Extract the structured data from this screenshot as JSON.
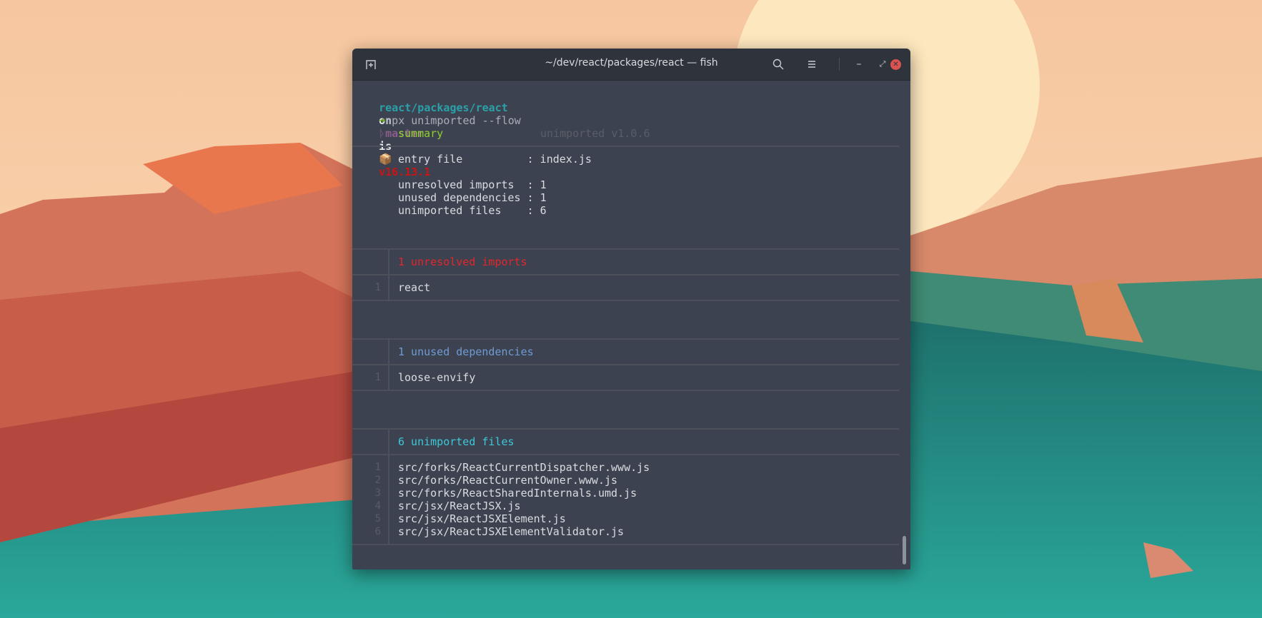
{
  "window": {
    "title": "~/dev/react/packages/react — fish",
    "new_tab_icon": "new-tab-icon",
    "search_icon": "search-icon",
    "menu_icon": "hamburger-menu-icon",
    "minimize_icon": "–",
    "maximize_icon": "⤢",
    "close_icon": "✕"
  },
  "prompt": {
    "path": "react/packages/react",
    "on": "on",
    "branch_icon": "",
    "branch": "master",
    "is": "is",
    "package_icon": "📦",
    "version": "v16.13.1",
    "arrow": "➜",
    "command": "npx unimported --flow"
  },
  "summary": {
    "title": "summary",
    "tool_version": "unimported v1.0.6",
    "entry_file": "entry file          : index.js",
    "unresolved": "unresolved imports  : 1",
    "unused": "unused dependencies : 1",
    "unimported": "unimported files    : 6"
  },
  "sections": [
    {
      "heading": "1 unresolved imports",
      "items": [
        {
          "n": "1",
          "text": "react"
        }
      ]
    },
    {
      "heading": "1 unused dependencies",
      "items": [
        {
          "n": "1",
          "text": "loose-envify"
        }
      ]
    },
    {
      "heading": "6 unimported files",
      "items": [
        {
          "n": "1",
          "text": "src/forks/ReactCurrentDispatcher.www.js"
        },
        {
          "n": "2",
          "text": "src/forks/ReactCurrentOwner.www.js"
        },
        {
          "n": "3",
          "text": "src/forks/ReactSharedInternals.umd.js"
        },
        {
          "n": "4",
          "text": "src/jsx/ReactJSX.js"
        },
        {
          "n": "5",
          "text": "src/jsx/ReactJSXElement.js"
        },
        {
          "n": "6",
          "text": "src/jsx/ReactJSXElementValidator.js"
        }
      ]
    }
  ],
  "colors": {
    "path": "#2aa1a8",
    "branch": "#8c5d8c",
    "version": "#cc1414",
    "arrow": "#6fb01c",
    "summary": "#8fd12a",
    "unresolved": "#e3262b",
    "unused": "#6e9bd2",
    "unimported": "#3cc8d8"
  }
}
